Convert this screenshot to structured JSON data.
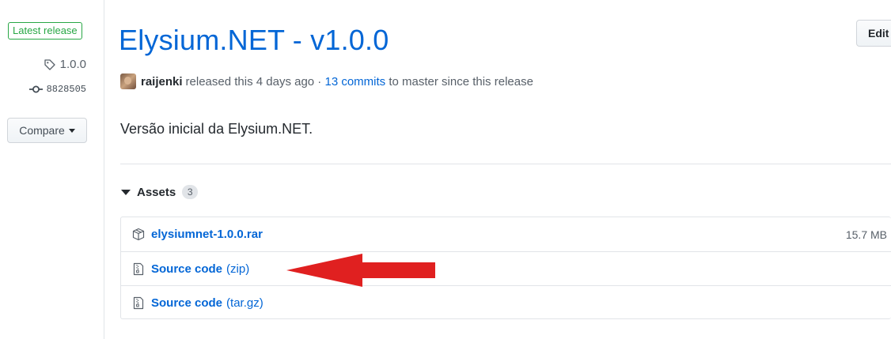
{
  "sidebar": {
    "badge": "Latest release",
    "tag": "1.0.0",
    "commit": "8828505",
    "compare_label": "Compare"
  },
  "header": {
    "title": "Elysium.NET - v1.0.0",
    "edit_label": "Edit"
  },
  "meta": {
    "author": "raijenki",
    "released_text": "released this 4 days ago ·",
    "commits_link": "13 commits",
    "branch_text": "to master since this release"
  },
  "description": "Versão inicial da Elysium.NET.",
  "assets": {
    "label": "Assets",
    "count": "3",
    "items": [
      {
        "name": "elysiumnet-1.0.0.rar",
        "suffix": "",
        "size": "15.7 MB",
        "icon": "package-icon"
      },
      {
        "name": "Source code",
        "suffix": "(zip)",
        "size": "",
        "icon": "file-zip-icon"
      },
      {
        "name": "Source code",
        "suffix": "(tar.gz)",
        "size": "",
        "icon": "file-zip-icon"
      }
    ]
  },
  "colors": {
    "link": "#0366d6",
    "badge": "#28a745",
    "arrow": "#e02020"
  }
}
